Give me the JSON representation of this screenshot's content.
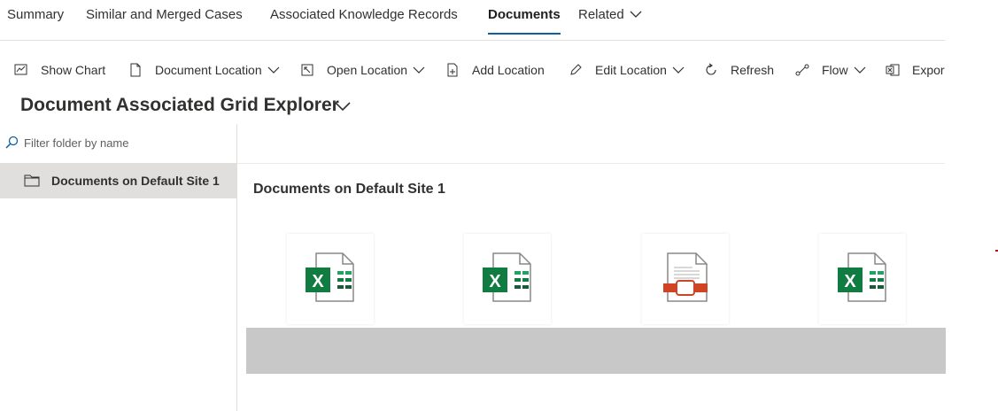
{
  "tabs": {
    "summary": "Summary",
    "similar": "Similar and Merged Cases",
    "knowledge": "Associated Knowledge Records",
    "documents": "Documents",
    "related": "Related"
  },
  "commands": {
    "show_chart": "Show Chart",
    "document_location": "Document Location",
    "open_location": "Open Location",
    "add_location": "Add Location",
    "edit_location": "Edit Location",
    "refresh": "Refresh",
    "flow": "Flow",
    "export": "Export"
  },
  "grid": {
    "title": "Document Associated Grid Explorer"
  },
  "left_pane": {
    "filter_placeholder": "Filter folder by name",
    "folders": [
      {
        "label": "Documents on Default Site 1"
      }
    ]
  },
  "main": {
    "folder_heading": "Documents on Default Site 1",
    "files": [
      {
        "type": "excel-file-icon"
      },
      {
        "type": "excel-file-icon"
      },
      {
        "type": "powerpoint-file-icon"
      },
      {
        "type": "excel-file-icon"
      }
    ]
  },
  "colors": {
    "accent": "#115ea3",
    "excel": "#107c41",
    "powerpoint": "#d04423",
    "selected_row": "#e1dfdd"
  }
}
